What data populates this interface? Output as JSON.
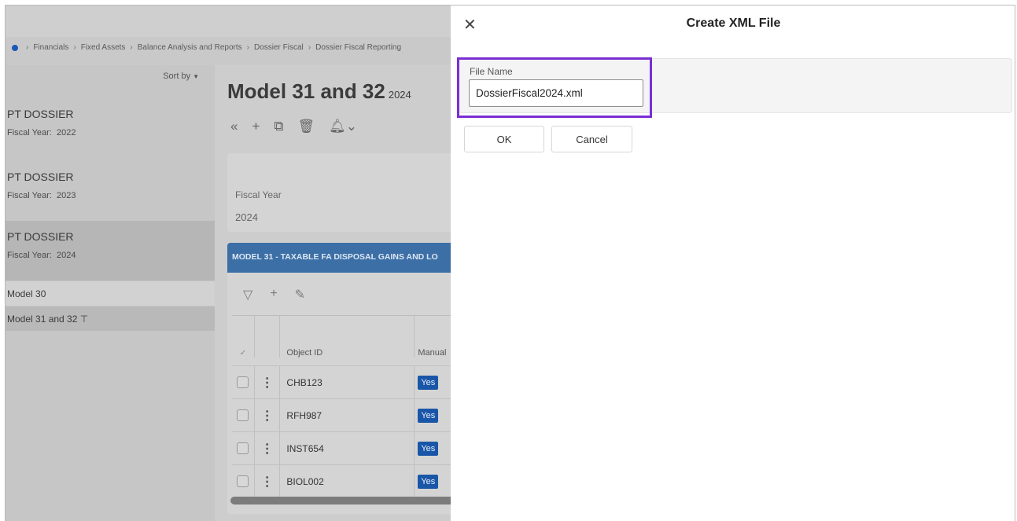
{
  "breadcrumb": [
    "Financials",
    "Fixed Assets",
    "Balance Analysis and Reports",
    "Dossier Fiscal",
    "Dossier Fiscal Reporting"
  ],
  "list": {
    "sort_label": "Sort by",
    "dossiers": [
      {
        "title": "PT DOSSIER",
        "fiscal_label": "Fiscal Year:",
        "year": "2022"
      },
      {
        "title": "PT DOSSIER",
        "fiscal_label": "Fiscal Year:",
        "year": "2023"
      },
      {
        "title": "PT DOSSIER",
        "fiscal_label": "Fiscal Year:",
        "year": "2024"
      }
    ],
    "subitems": [
      "Model 30",
      "Model 31 and 32"
    ]
  },
  "main": {
    "title": "Model 31 and 32",
    "year_select": "2024",
    "fiscal_year_label": "Fiscal Year",
    "fiscal_year_value": "2024",
    "section_title": "MODEL 31 - TAXABLE FA DISPOSAL GAINS AND LO",
    "columns": {
      "object_id": "Object ID",
      "manual": "Manual"
    },
    "rows": [
      {
        "object_id": "CHB123",
        "manual": "Yes"
      },
      {
        "object_id": "RFH987",
        "manual": "Yes"
      },
      {
        "object_id": "INST654",
        "manual": "Yes"
      },
      {
        "object_id": "BIOL002",
        "manual": "Yes"
      }
    ]
  },
  "dialog": {
    "title": "Create XML File",
    "file_name_label": "File Name",
    "file_name_value": "DossierFiscal2024.xml",
    "ok_label": "OK",
    "cancel_label": "Cancel"
  },
  "colors": {
    "accent": "#1a56a8",
    "highlight": "#7a2ed3",
    "section_header": "#3c6fa6"
  }
}
